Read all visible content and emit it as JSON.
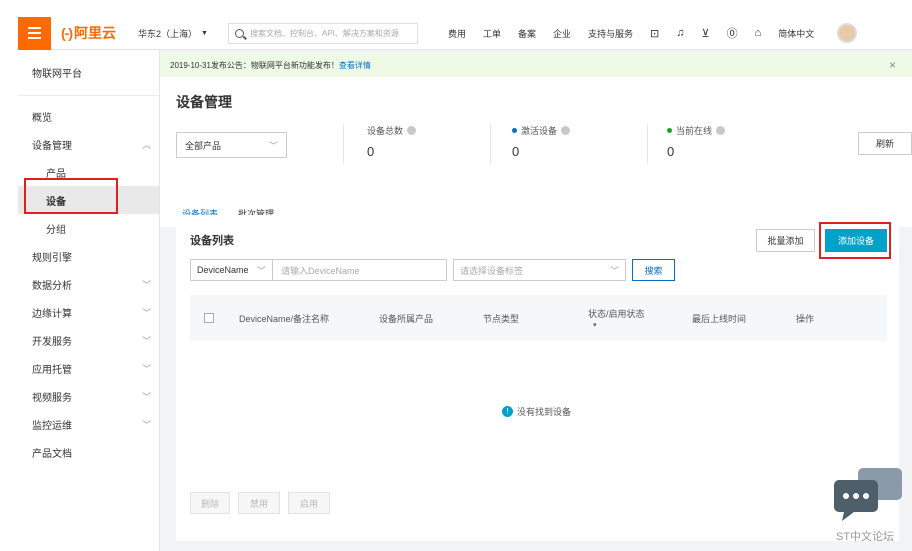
{
  "topbar": {
    "logo_mark": "(-)",
    "logo_text": "阿里云",
    "region": "华东2（上海）",
    "search_placeholder": "搜索文档、控制台、API、解决方案和资源",
    "nav": [
      "费用",
      "工单",
      "备案",
      "企业",
      "支持与服务"
    ],
    "language": "简体中文",
    "icons": [
      "terminal-icon",
      "bell-icon",
      "cart-icon",
      "help-icon",
      "home-icon"
    ]
  },
  "sidebar": {
    "title": "物联网平台",
    "items": [
      {
        "label": "概览",
        "chevron": ""
      },
      {
        "label": "设备管理",
        "chevron": "︿"
      },
      {
        "label": "产品",
        "chevron": ""
      },
      {
        "label": "设备",
        "chevron": ""
      },
      {
        "label": "分组",
        "chevron": ""
      },
      {
        "label": "规则引擎",
        "chevron": ""
      },
      {
        "label": "数据分析",
        "chevron": "﹀"
      },
      {
        "label": "边缘计算",
        "chevron": "﹀"
      },
      {
        "label": "开发服务",
        "chevron": "﹀"
      },
      {
        "label": "应用托管",
        "chevron": "﹀"
      },
      {
        "label": "视频服务",
        "chevron": "﹀"
      },
      {
        "label": "监控运维",
        "chevron": "﹀"
      },
      {
        "label": "产品文档",
        "chevron": ""
      }
    ]
  },
  "notice": {
    "text": "2019-10-31发布公告：物联网平台新功能发布！",
    "link": "查看详情"
  },
  "main": {
    "title": "设备管理",
    "product_select": "全部产品",
    "stats": [
      {
        "label": "设备总数",
        "value": "0",
        "dot_color": ""
      },
      {
        "label": "激活设备",
        "value": "0",
        "dot_color": "#0070cc"
      },
      {
        "label": "当前在线",
        "value": "0",
        "dot_color": "#1ea51e"
      }
    ],
    "refresh": "刷新",
    "tabs": [
      "设备列表",
      "批次管理"
    ]
  },
  "list": {
    "title": "设备列表",
    "bulk_add": "批量添加",
    "add_device": "添加设备",
    "filter_select": "DeviceName",
    "filter_placeholder": "请输入DeviceName",
    "tag_placeholder": "请选择设备标签",
    "search": "搜索",
    "columns": [
      "DeviceName/备注名称",
      "设备所属产品",
      "节点类型",
      "状态/启用状态",
      "最后上线时间",
      "操作"
    ],
    "empty_text": "没有找到设备",
    "footer_buttons": [
      "删除",
      "禁用",
      "启用"
    ]
  },
  "watermark": "ST中文论坛",
  "colors": {
    "brand": "#ff6a00",
    "primary": "#00a2ca",
    "link": "#0070cc",
    "highlight": "#e02020"
  }
}
